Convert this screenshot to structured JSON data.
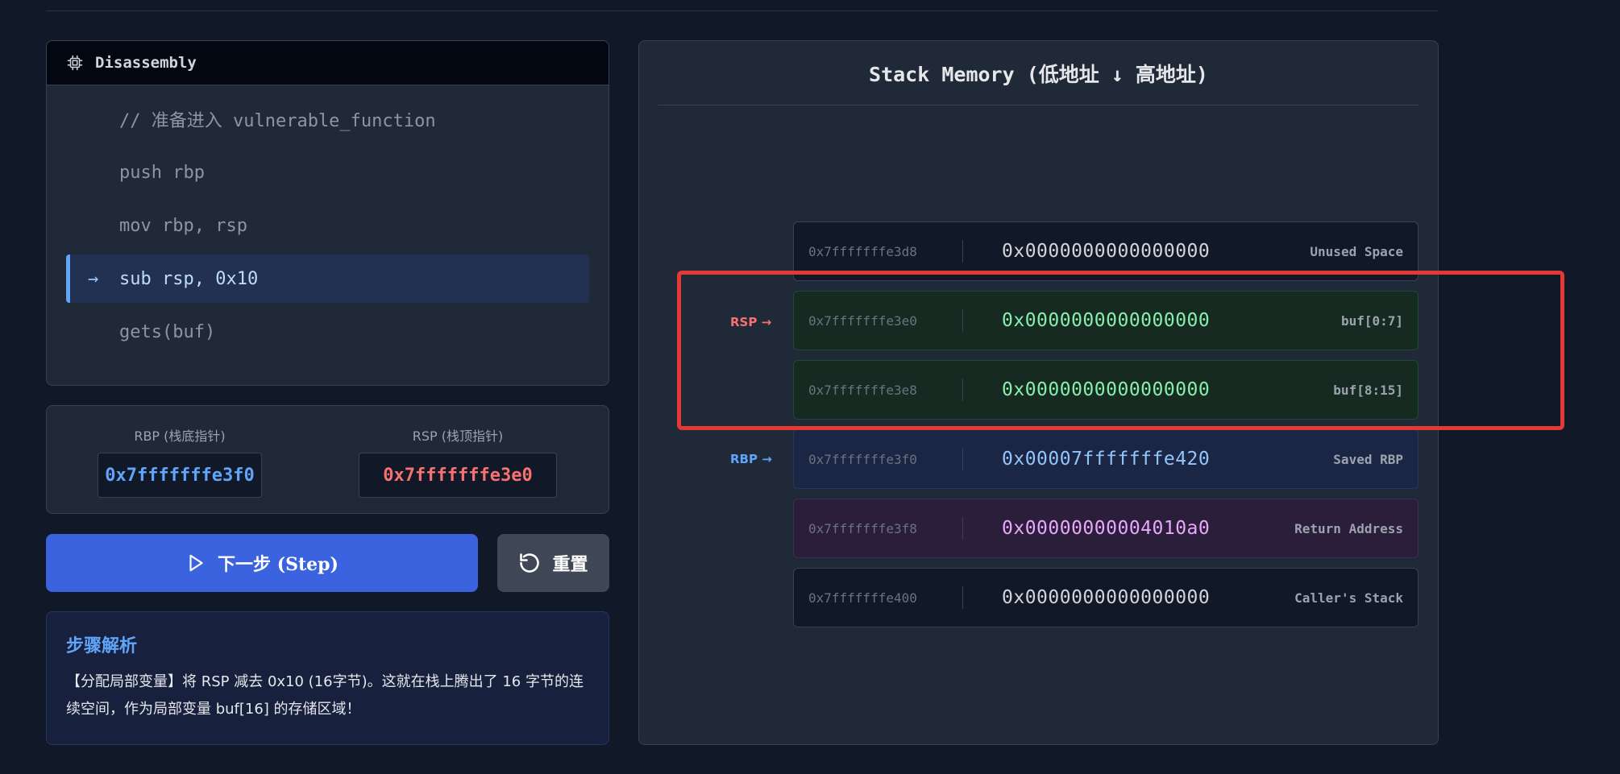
{
  "disassembly": {
    "title": "Disassembly",
    "lines": [
      {
        "text": "// 准备进入 vulnerable_function",
        "active": false
      },
      {
        "text": "push rbp",
        "active": false
      },
      {
        "text": "mov rbp, rsp",
        "active": false
      },
      {
        "text": "sub rsp, 0x10",
        "active": true
      },
      {
        "text": "gets(buf)",
        "active": false
      }
    ]
  },
  "registers": {
    "rbp_label": "RBP (栈底指针)",
    "rbp_value": "0x7fffffffe3f0",
    "rsp_label": "RSP (栈顶指针)",
    "rsp_value": "0x7fffffffe3e0"
  },
  "buttons": {
    "step_label": "下一步 (Step)",
    "reset_label": "重置"
  },
  "explanation": {
    "title": "步骤解析",
    "text": "【分配局部变量】将 RSP 减去 0x10 (16字节)。这就在栈上腾出了 16 字节的连续空间，作为局部变量 buf[16] 的存储区域！"
  },
  "stack": {
    "title": "Stack Memory (低地址 ↓ 高地址)",
    "rsp_marker": "RSP →",
    "rbp_marker": "RBP →",
    "rows": [
      {
        "address": "0x7fffffffe3d8",
        "value": "0x0000000000000000",
        "label": "Unused Space",
        "kind": "unused"
      },
      {
        "address": "0x7fffffffe3e0",
        "value": "0x0000000000000000",
        "label": "buf[0:7]",
        "kind": "buf"
      },
      {
        "address": "0x7fffffffe3e8",
        "value": "0x0000000000000000",
        "label": "buf[8:15]",
        "kind": "buf"
      },
      {
        "address": "0x7fffffffe3f0",
        "value": "0x00007fffffffe420",
        "label": "Saved RBP",
        "kind": "rbp"
      },
      {
        "address": "0x7fffffffe3f8",
        "value": "0x00000000004010a0",
        "label": "Return Address",
        "kind": "ret"
      },
      {
        "address": "0x7fffffffe400",
        "value": "0x0000000000000000",
        "label": "Caller's Stack",
        "kind": "caller"
      }
    ]
  },
  "colors": {
    "rsp": "#f87171",
    "rbp": "#60a5fa",
    "highlight": "#e53935"
  }
}
